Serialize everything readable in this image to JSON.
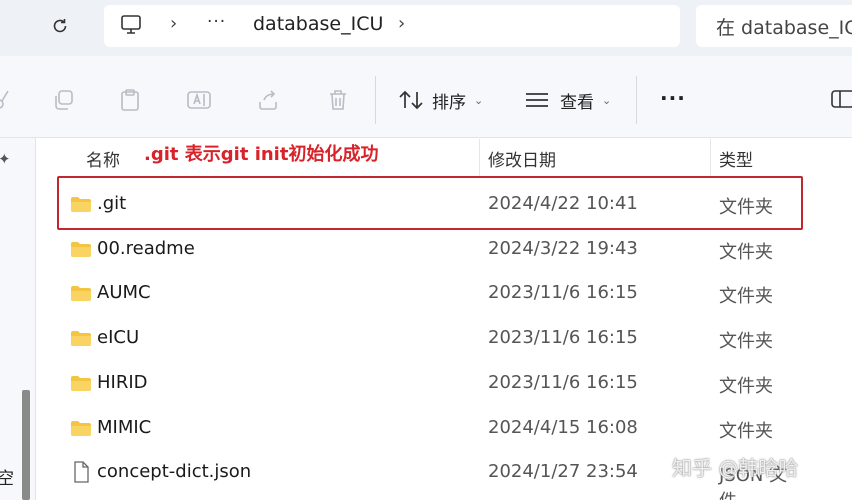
{
  "address_bar": {
    "breadcrumb_more": "···",
    "current_folder": "database_ICU",
    "search_placeholder": "在 database_ICU"
  },
  "toolbar": {
    "sort_label": "排序",
    "view_label": "查看",
    "more_label": "···"
  },
  "annotation": ".git 表示git init初始化成功",
  "columns": {
    "name": "名称",
    "date": "修改日期",
    "type": "类型"
  },
  "rows": [
    {
      "name": ".git",
      "date": "2024/4/22 10:41",
      "type": "文件夹",
      "icon": "folder-icon"
    },
    {
      "name": "00.readme",
      "date": "2024/3/22 19:43",
      "type": "文件夹",
      "icon": "folder-icon"
    },
    {
      "name": "AUMC",
      "date": "2023/11/6 16:15",
      "type": "文件夹",
      "icon": "folder-icon"
    },
    {
      "name": "eICU",
      "date": "2023/11/6 16:15",
      "type": "文件夹",
      "icon": "folder-icon"
    },
    {
      "name": "HIRID",
      "date": "2023/11/6 16:15",
      "type": "文件夹",
      "icon": "folder-icon"
    },
    {
      "name": "MIMIC",
      "date": "2024/4/15 16:08",
      "type": "文件夹",
      "icon": "folder-icon"
    },
    {
      "name": "concept-dict.json",
      "date": "2024/1/27 23:54",
      "type": "JSON 文件",
      "icon": "json-file-icon"
    }
  ],
  "left_nav": {
    "partial_label": "空"
  },
  "watermark": "知乎 @韩晗哈",
  "colors": {
    "highlight": "#c0282f",
    "annotation": "#d8232a",
    "folder": "#f4c542"
  }
}
